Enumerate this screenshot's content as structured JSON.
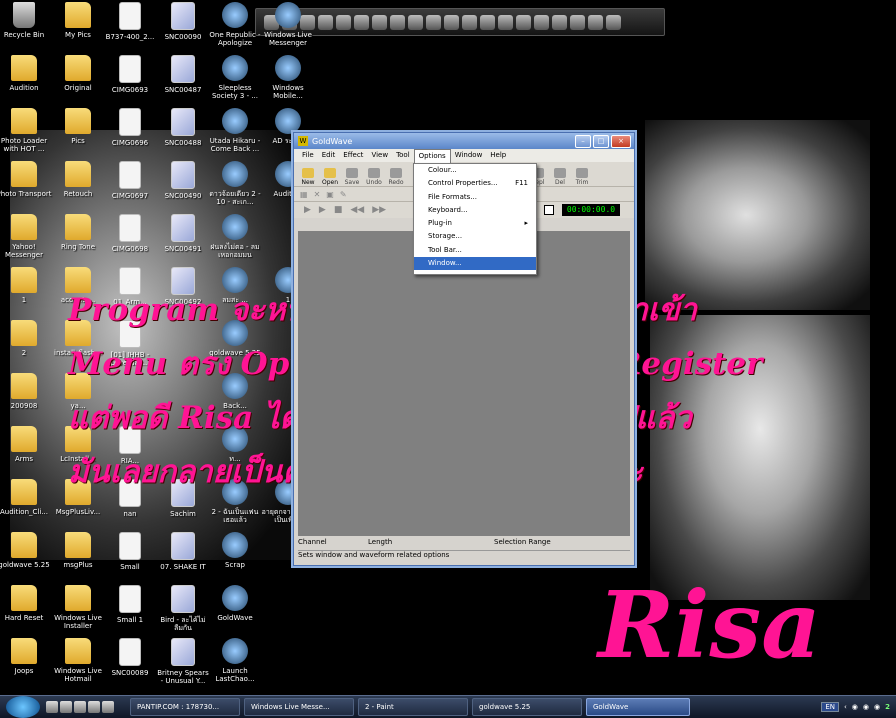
{
  "desktop_icons": [
    [
      "Recycle Bin",
      "My Pics",
      "B737-400_2...",
      "SNC00090",
      "One Republic - Apologize",
      "Windows Live Messenger"
    ],
    [
      "Audition",
      "Original",
      "CIMG0693",
      "SNC00487",
      "Sleepless Society 3 - ...",
      "Windows Mobile..."
    ],
    [
      "Photo Loader with HOT ...",
      "Pics",
      "CIMG0696",
      "SNC00488",
      "Utada Hikaru - Come Back ...",
      "AD ระบั..."
    ],
    [
      "Photo Transport",
      "Retouch",
      "CIMG0697",
      "SNC00490",
      "ดาวจ้อยเดียว 2 - 10 - สะเก...",
      "Audition"
    ],
    [
      "Yahoo! Messenger",
      "Ring Tone",
      "CIMG0698",
      "SNC00491",
      "ฝนลงไม่ตอ - ลม เหอกอมมน",
      ""
    ],
    [
      "1",
      "acounts...",
      "01_Arm...",
      "SNC00492",
      "ลมสะ ... ",
      "1"
    ],
    [
      "2",
      "install_flash...",
      "[01] IHHB - Love Nak...",
      "",
      "goldwave 5.25",
      ""
    ],
    [
      "200908",
      "ya...",
      "",
      "",
      "Back...",
      ""
    ],
    [
      "Arms",
      "LcInstall...",
      "RIA...",
      "",
      "ท...",
      ""
    ],
    [
      "Audition_Cli...",
      "MsgPlusLiv...",
      "nan",
      "Sachim",
      "2 - ฉันเป็นแฟน เธอแล้ว",
      "อายุตกจาก ความเป็นเพือน"
    ],
    [
      "goldwave 5.25",
      "msgPlus",
      "Small",
      "07. SHAKE IT",
      "Scrap",
      ""
    ],
    [
      "Hard Reset",
      "Windows Live Installer",
      "Small 1",
      "Bird - ละไค้ไม่ ลืมกัน",
      "GoldWave",
      ""
    ],
    [
      "Joops",
      "Windows Live Hotmail",
      "SNC00089",
      "Britney Spears - Unusual Y...",
      "Launch LastChao...",
      ""
    ]
  ],
  "goldwave": {
    "title": "GoldWave",
    "menu": [
      "File",
      "Edit",
      "Effect",
      "View",
      "Tool",
      "Options",
      "Window",
      "Help"
    ],
    "active_menu": "Options",
    "toolbar": [
      "New",
      "Open",
      "Save",
      "Undo",
      "Redo",
      "Repl",
      "Del",
      "Trim"
    ],
    "time": "00:00:00.0",
    "status_cols": [
      "Channel",
      "Length",
      "Selection Range"
    ],
    "status_text": "Sets window and waveform related options"
  },
  "options_menu": [
    {
      "label": "Colour...",
      "shortcut": ""
    },
    {
      "label": "Control Properties...",
      "shortcut": "F11"
    },
    {
      "label": "File Formats...",
      "shortcut": ""
    },
    {
      "label": "Keyboard...",
      "shortcut": ""
    },
    {
      "label": "Plug-in",
      "shortcut": "▸"
    },
    {
      "label": "Storage...",
      "shortcut": ""
    },
    {
      "label": "Tool Bar...",
      "shortcut": ""
    },
    {
      "label": "Window...",
      "shortcut": "",
      "selected": true
    }
  ],
  "overlay_text": [
    "Program จะหน้าตาแบบนี้ค่ะ แล้วเราก็มาเข้า",
    "Menu ตรง Options ค่ะ มันจะมีคำว่า Register",
    "แต่พอดี Risa ได้ทำการ Registered ไปแล้ว",
    "มันเลยกลายเป็นคำว่า Window... แทนค่ะ"
  ],
  "signature": "Risa",
  "taskbar": {
    "tasks": [
      "PANTIP.COM : 178730...",
      "Windows Live Messe...",
      "2 - Paint",
      "goldwave 5.25",
      "GoldWave"
    ],
    "active_task": "GoldWave",
    "lang": "EN",
    "clock": "2"
  },
  "colors": {
    "overlay": "#ff1494",
    "taskbar": "#1f2a40",
    "menu_highlight": "#316ac5"
  }
}
